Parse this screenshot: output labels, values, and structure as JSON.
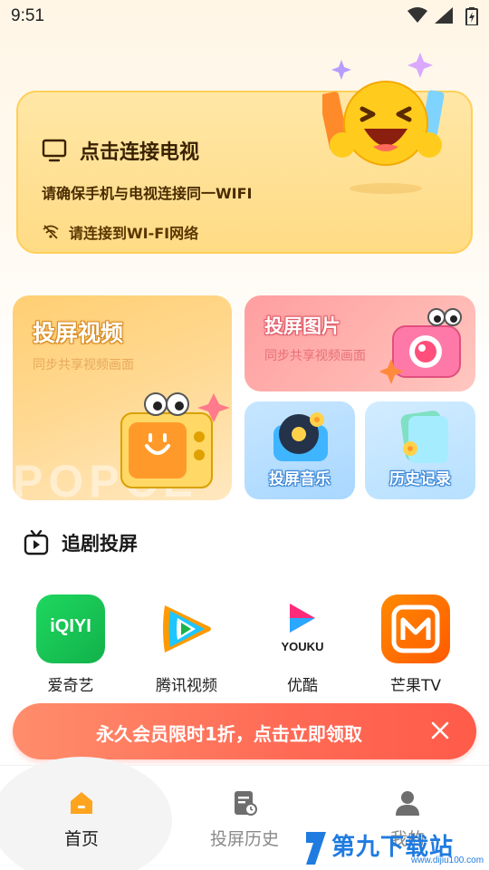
{
  "status_bar": {
    "time": "9:51",
    "icons": [
      "wifi-icon",
      "signal-icon",
      "battery-charging-icon"
    ]
  },
  "connect_card": {
    "title": "点击连接电视",
    "description": "请确保手机与电视连接同一WIFI",
    "wifi_hint": "请连接到WI-FI网络",
    "icons": [
      "tv-icon",
      "wifi-off-icon",
      "laughing-emoji-illustration"
    ]
  },
  "features": {
    "video": {
      "title": "投屏视频",
      "subtitle": "同步共享视频画面",
      "watermark": "POPCE"
    },
    "image": {
      "title": "投屏图片",
      "subtitle": "同步共享视频画面"
    },
    "music": {
      "title": "投屏音乐"
    },
    "history": {
      "title": "历史记录"
    }
  },
  "section": {
    "title": "追剧投屏",
    "icon": "tv-play-icon"
  },
  "apps": [
    {
      "label": "爱奇艺",
      "icon_text": "iQIYI",
      "color": "#1fc95a"
    },
    {
      "label": "腾讯视频",
      "icon_text": "",
      "color": "#ff8a00"
    },
    {
      "label": "优酷",
      "icon_text": "YOUKU",
      "color": "#ff2a7a"
    },
    {
      "label": "芒果TV",
      "icon_text": "",
      "color": "#ff6a00"
    }
  ],
  "promo": {
    "text": "永久会员限时1折，点击立即领取",
    "close_icon": "close-icon"
  },
  "bottom_nav": {
    "items": [
      {
        "label": "首页",
        "icon": "home-icon",
        "active": true
      },
      {
        "label": "投屏历史",
        "icon": "history-doc-icon",
        "active": false
      },
      {
        "label": "我的",
        "icon": "person-icon",
        "active": false
      }
    ]
  },
  "overlay_watermark": {
    "text": "第九下载站",
    "url": "www.dijiu100.com"
  },
  "colors": {
    "accent_orange": "#ffcf5a",
    "promo_red": "#ff6a55",
    "blue_label": "#3a86d6"
  }
}
